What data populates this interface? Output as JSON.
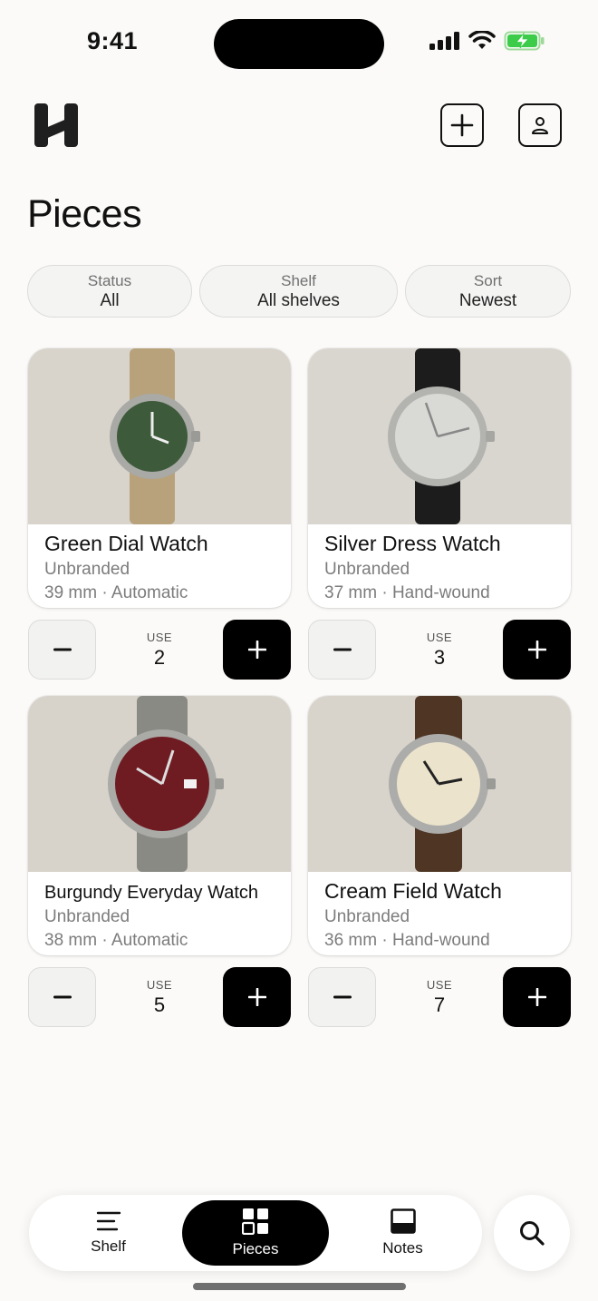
{
  "status_bar": {
    "time": "9:41"
  },
  "header": {
    "title": "Pieces"
  },
  "filters": [
    {
      "label": "Status",
      "value": "All"
    },
    {
      "label": "Shelf",
      "value": "All shelves"
    },
    {
      "label": "Sort",
      "value": "Newest"
    }
  ],
  "use_label": "USE",
  "pieces": [
    {
      "name": "Green Dial Watch",
      "brand": "Unbranded",
      "spec": "39 mm · Automatic",
      "use": "2",
      "dial_color": "#3d5a3a",
      "strap_color": "#b7a27c"
    },
    {
      "name": "Silver Dress Watch",
      "brand": "Unbranded",
      "spec": "37 mm · Hand-wound",
      "use": "3",
      "dial_color": "#d9d9d6",
      "strap_color": "#1c1c1c"
    },
    {
      "name": "Burgundy Everyday Watch",
      "brand": "Unbranded",
      "spec": "38 mm · Automatic",
      "use": "5",
      "dial_color": "#6e1c22",
      "strap_color": "#8a8a85"
    },
    {
      "name": "Cream Field Watch",
      "brand": "Unbranded",
      "spec": "36 mm · Hand-wound",
      "use": "7",
      "dial_color": "#ebe3cc",
      "strap_color": "#4e3524"
    }
  ],
  "tabs": [
    {
      "label": "Shelf",
      "icon": "shelf-lines-icon"
    },
    {
      "label": "Pieces",
      "icon": "pieces-grid-icon",
      "active": true
    },
    {
      "label": "Notes",
      "icon": "notes-icon"
    }
  ]
}
